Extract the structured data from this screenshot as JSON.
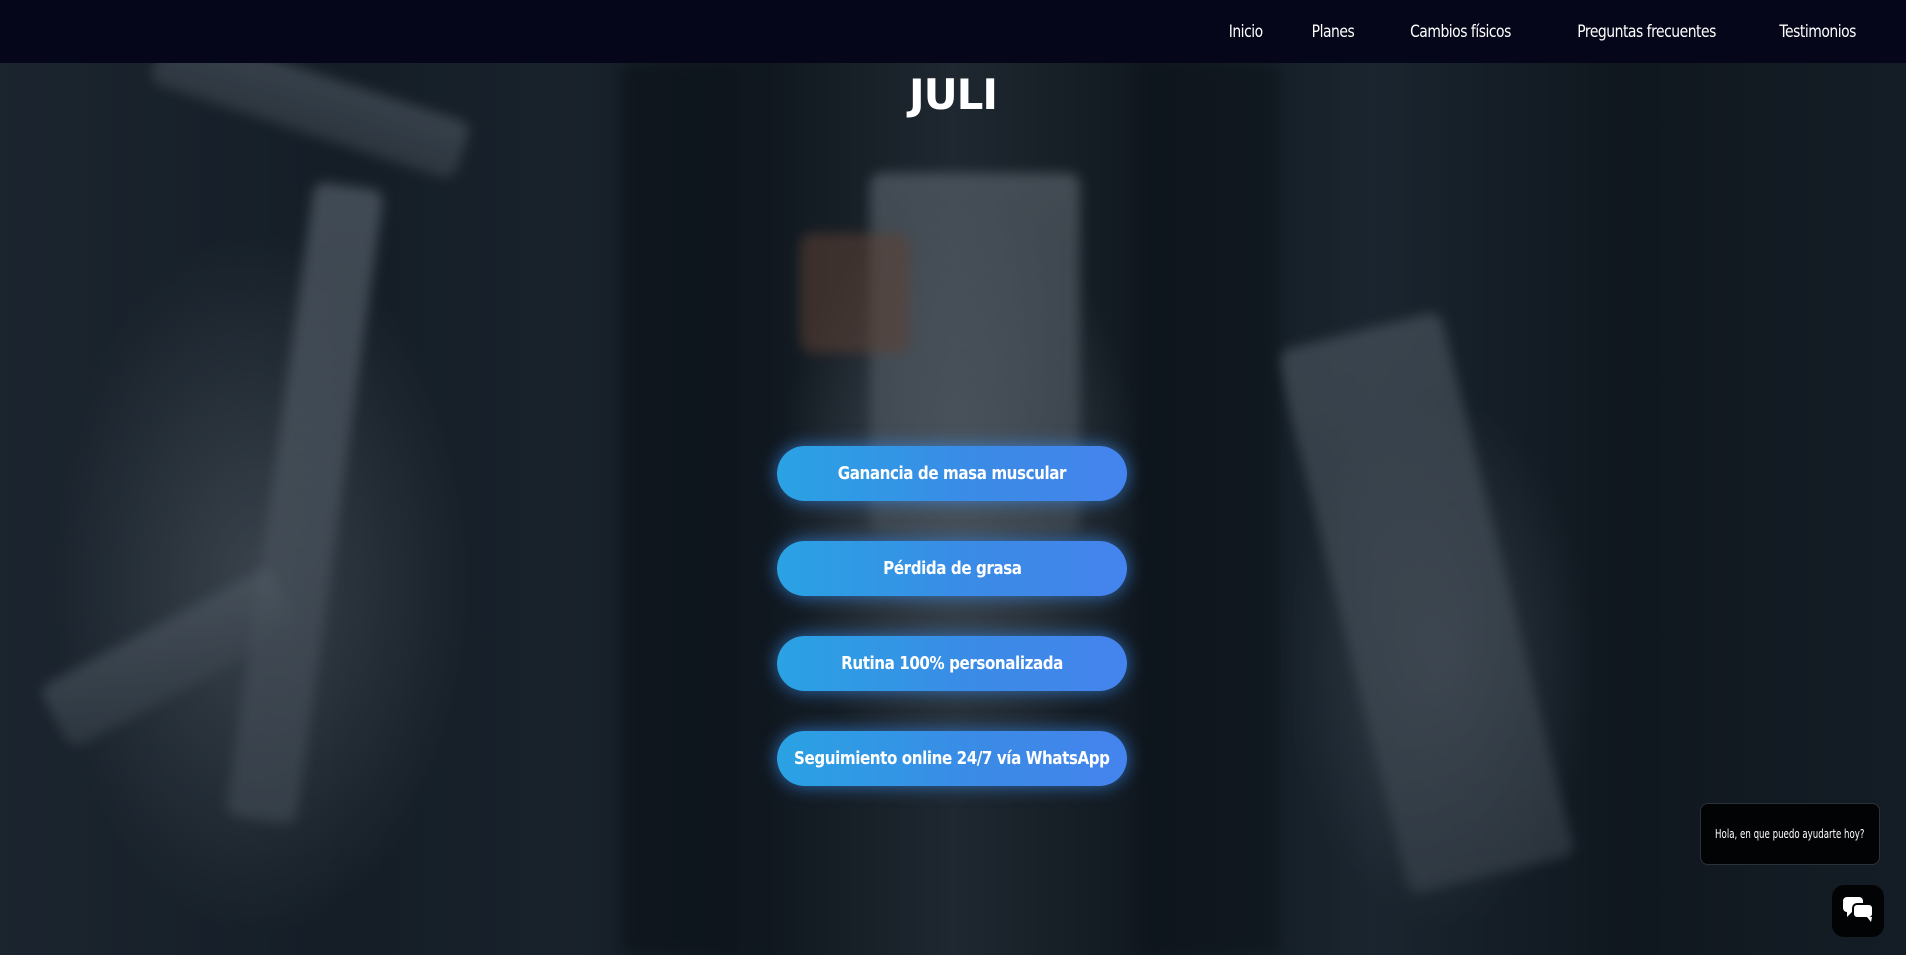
{
  "nav": {
    "items": [
      {
        "label": "Inicio"
      },
      {
        "label": "Planes"
      },
      {
        "label": "Cambios físicos"
      },
      {
        "label": "Preguntas frecuentes"
      },
      {
        "label": "Testimonios"
      }
    ]
  },
  "hero": {
    "brand": "JULI",
    "buttons": [
      {
        "label": "Ganancia de masa muscular"
      },
      {
        "label": "Pérdida de grasa"
      },
      {
        "label": "Rutina 100% personalizada"
      },
      {
        "label": "Seguimiento online 24/7 vía WhatsApp"
      }
    ]
  },
  "chat": {
    "greeting": "Hola, en que puedo ayudarte hoy?",
    "icon": "chat-bubbles-icon"
  },
  "colors": {
    "nav_bg": "#05061a",
    "button_start": "#2aa2e4",
    "button_end": "#4584ee",
    "chat_bg": "#020304"
  }
}
